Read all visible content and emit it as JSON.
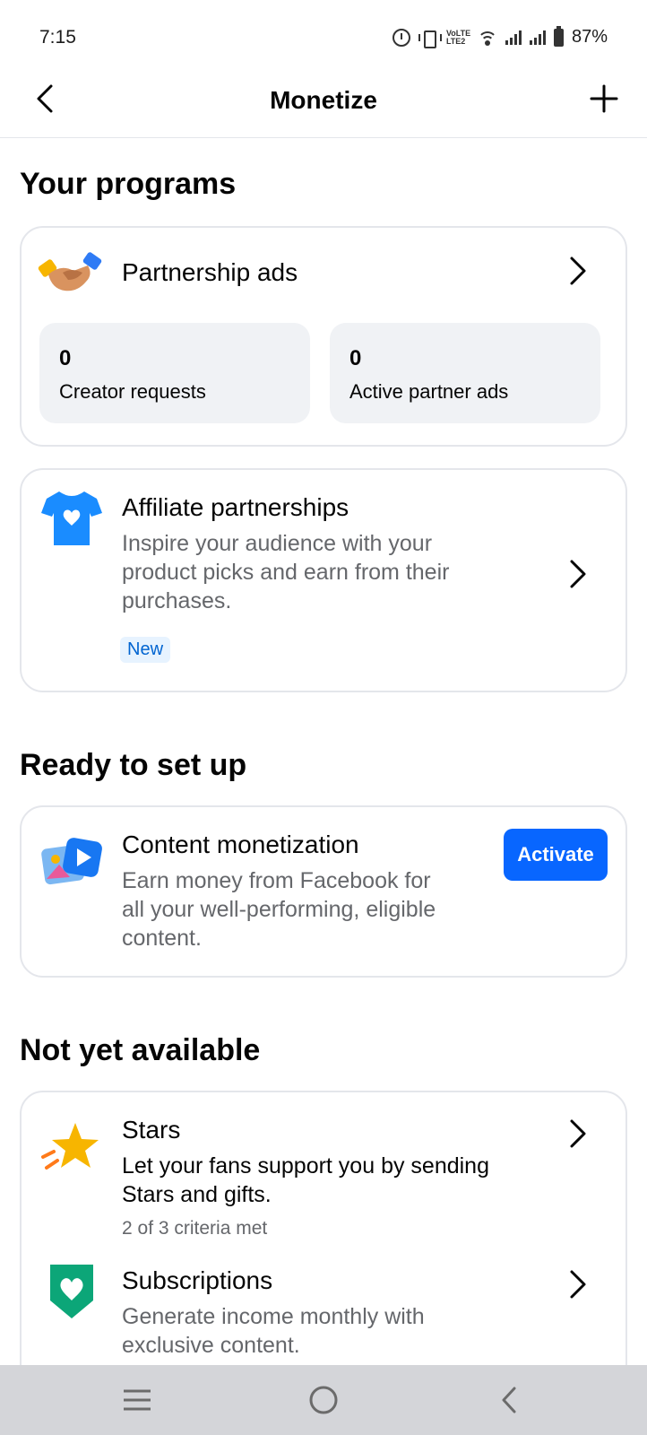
{
  "status_bar": {
    "time": "7:15",
    "network_label": "VoLTE LTE2",
    "battery": "87%"
  },
  "header": {
    "title": "Monetize",
    "back_icon": "back-arrow-icon",
    "add_icon": "plus-icon"
  },
  "sections": {
    "your_programs": "Your programs",
    "ready_to_set_up": "Ready to set up",
    "not_yet_available": "Not yet available"
  },
  "partnership_ads": {
    "title": "Partnership ads",
    "icon": "handshake-icon",
    "stats": [
      {
        "value": "0",
        "label": "Creator requests"
      },
      {
        "value": "0",
        "label": "Active partner ads"
      }
    ]
  },
  "affiliate": {
    "title": "Affiliate partnerships",
    "icon": "tshirt-heart-icon",
    "desc_line1": "Inspire your audience with your",
    "desc_line2": "product picks and earn from their",
    "desc_line3": "purchases.",
    "badge": "New"
  },
  "content_monetization": {
    "title": "Content monetization",
    "icon": "photo-video-icon",
    "desc_line1": "Earn money from Facebook for",
    "desc_line2": "all your well-performing, eligible",
    "desc_line3": "content.",
    "button": "Activate"
  },
  "stars": {
    "title": "Stars",
    "icon": "star-icon",
    "desc_line1": "Let your fans support you by sending",
    "desc_line2": "Stars and gifts.",
    "criteria": "2 of 3 criteria met"
  },
  "subscriptions": {
    "title": "Subscriptions",
    "icon": "heart-badge-icon",
    "desc_line1": "Generate income monthly with",
    "desc_line2": "exclusive content."
  },
  "colors": {
    "accent": "#0866ff",
    "secondary_text": "#65676b",
    "card_border": "#e4e6eb",
    "nav_bar": "#d4d5d9"
  }
}
